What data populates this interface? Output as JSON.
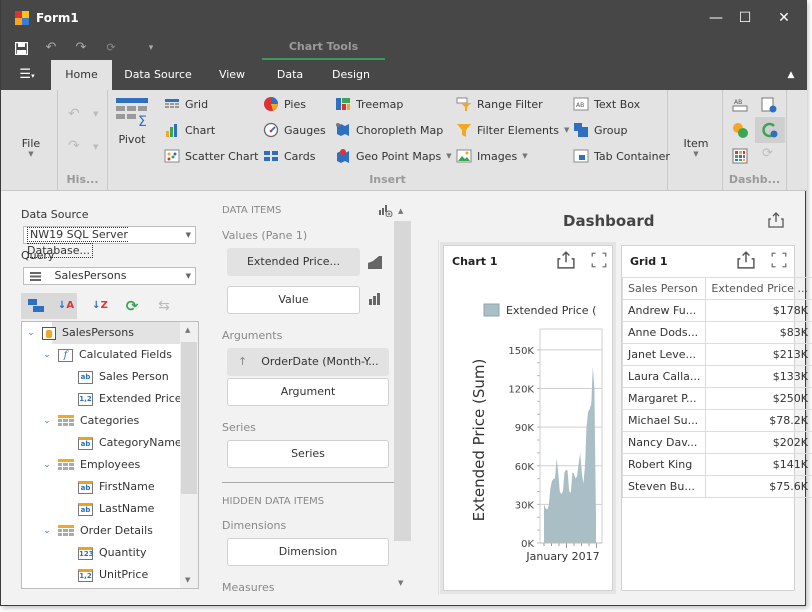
{
  "window": {
    "title": "Form1",
    "minimize": "—",
    "maximize": "☐",
    "close": "✕"
  },
  "qat": {
    "save": "save-icon",
    "undo": "undo-icon",
    "redo": "redo-icon",
    "refresh": "refresh-icon",
    "customize": "▾"
  },
  "context_group": "Chart Tools",
  "tabs": [
    {
      "label": "Home",
      "active": true
    },
    {
      "label": "Data Source",
      "active": false
    },
    {
      "label": "View",
      "active": false
    },
    {
      "label": "Data",
      "active": false
    },
    {
      "label": "Design",
      "active": false
    }
  ],
  "ribbon": {
    "file": "File",
    "history_group": "His...",
    "insert_group": "Insert",
    "dashboard_group": "Dashb...",
    "pivot": "Pivot",
    "item": "Item",
    "insert_col1": [
      "Grid",
      "Chart",
      "Scatter Chart"
    ],
    "insert_col2": [
      "Pies",
      "Gauges",
      "Cards"
    ],
    "insert_col3": [
      "Treemap",
      "Choropleth Map",
      "Geo Point Maps"
    ],
    "insert_col4": [
      "Range Filter",
      "Filter Elements",
      "Images"
    ],
    "insert_col5": [
      "Text Box",
      "Group",
      "Tab Container"
    ]
  },
  "left_panel": {
    "data_source_label": "Data Source",
    "data_source_value": "NW19 SQL Server Database...",
    "query_label": "Query",
    "query_value": "SalesPersons",
    "tree": [
      {
        "label": "SalesPersons",
        "level": 0,
        "type": "datasource"
      },
      {
        "label": "Calculated Fields",
        "level": 1,
        "type": "calc"
      },
      {
        "label": "Sales Person",
        "level": 2,
        "type": "ab"
      },
      {
        "label": "Extended Price",
        "level": 2,
        "type": "num"
      },
      {
        "label": "Categories",
        "level": 1,
        "type": "table"
      },
      {
        "label": "CategoryName",
        "level": 2,
        "type": "ab"
      },
      {
        "label": "Employees",
        "level": 1,
        "type": "table"
      },
      {
        "label": "FirstName",
        "level": 2,
        "type": "ab"
      },
      {
        "label": "LastName",
        "level": 2,
        "type": "ab"
      },
      {
        "label": "Order Details",
        "level": 1,
        "type": "table"
      },
      {
        "label": "Quantity",
        "level": 2,
        "type": "int"
      },
      {
        "label": "UnitPrice",
        "level": 2,
        "type": "num"
      }
    ]
  },
  "data_items": {
    "header": "DATA ITEMS",
    "values_label": "Values (Pane 1)",
    "value_item": "Extended Price...",
    "value_placeholder": "Value",
    "arguments_label": "Arguments",
    "argument_item": "OrderDate (Month-Y...",
    "argument_placeholder": "Argument",
    "series_label": "Series",
    "series_placeholder": "Series",
    "hidden_header": "HIDDEN DATA ITEMS",
    "dimensions_label": "Dimensions",
    "dimension_placeholder": "Dimension",
    "measures_label": "Measures"
  },
  "dashboard": {
    "title": "Dashboard",
    "chart": {
      "title": "Chart 1",
      "legend": "Extended Price ("
    },
    "grid": {
      "title": "Grid 1",
      "columns": [
        "Sales Person",
        "Extended Price ..."
      ],
      "rows": [
        [
          "Andrew Fu...",
          "$178K"
        ],
        [
          "Anne Dods...",
          "$83K"
        ],
        [
          "Janet Leve...",
          "$213K"
        ],
        [
          "Laura Calla...",
          "$133K"
        ],
        [
          "Margaret P...",
          "$250K"
        ],
        [
          "Michael Su...",
          "$78.2K"
        ],
        [
          "Nancy Dav...",
          "$202K"
        ],
        [
          "Robert King",
          "$141K"
        ],
        [
          "Steven Bu...",
          "$75.6K"
        ]
      ]
    }
  },
  "chart_data": {
    "type": "area",
    "title": "Chart 1",
    "ylabel": "Extended Price (Sum)",
    "xlabel": "",
    "x_tick_labels": [
      "January 2017"
    ],
    "y_ticks": [
      "0K",
      "30K",
      "60K",
      "90K",
      "120K",
      "150K"
    ],
    "ylim": [
      0,
      160000
    ],
    "legend": [
      "Extended Price ("
    ],
    "color": "#a9bfc5",
    "series": [
      {
        "name": "Extended Price (Sum)",
        "values": [
          30000,
          27000,
          26000,
          29000,
          42000,
          48000,
          50000,
          50000,
          66000,
          55000,
          40000,
          38000,
          40000,
          55000,
          57000,
          56000,
          40000,
          39000,
          55000,
          54000,
          50000,
          52000,
          62000,
          70000,
          55000,
          46000,
          60000,
          90000,
          102000,
          104000,
          108000,
          137000,
          120000,
          20000
        ]
      }
    ]
  }
}
